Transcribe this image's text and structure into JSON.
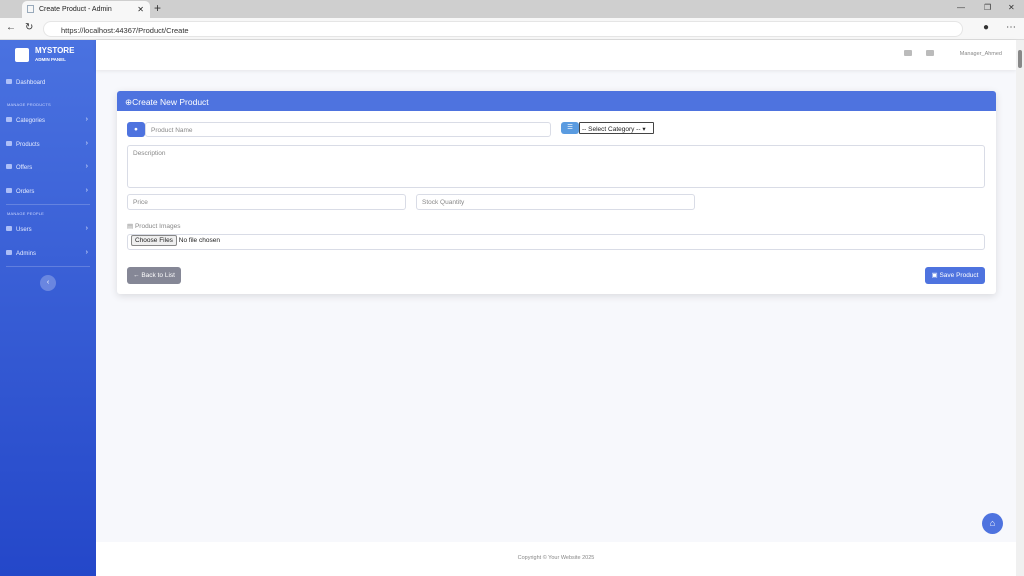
{
  "browser": {
    "tab_title": "Create Product - Admin",
    "url": "https://localhost:44367/Product/Create"
  },
  "sidebar": {
    "brand": "MYSTORE",
    "subtitle": "ADMIN PANEL",
    "dashboard": "Dashboard",
    "section1": "MANAGE PRODUCTS",
    "section2": "MANAGE PEOPLE",
    "items": [
      {
        "label": "Categories"
      },
      {
        "label": "Products"
      },
      {
        "label": "Offers"
      },
      {
        "label": "Orders"
      },
      {
        "label": "Users"
      },
      {
        "label": "Admins"
      }
    ]
  },
  "topbar": {
    "user": "Manager_Ahmed"
  },
  "form": {
    "title": "Create New Product",
    "name_placeholder": "Product Name",
    "category_selected": "-- Select Category --",
    "description_placeholder": "Description",
    "price_placeholder": "Price",
    "stock_placeholder": "Stock Quantity",
    "images_label": "Product Images",
    "choose_files": "Choose Files",
    "no_file": "No file chosen",
    "back": "Back to List",
    "save": "Save Product"
  },
  "footer": {
    "text": "Copyright © Your Website 2025"
  }
}
